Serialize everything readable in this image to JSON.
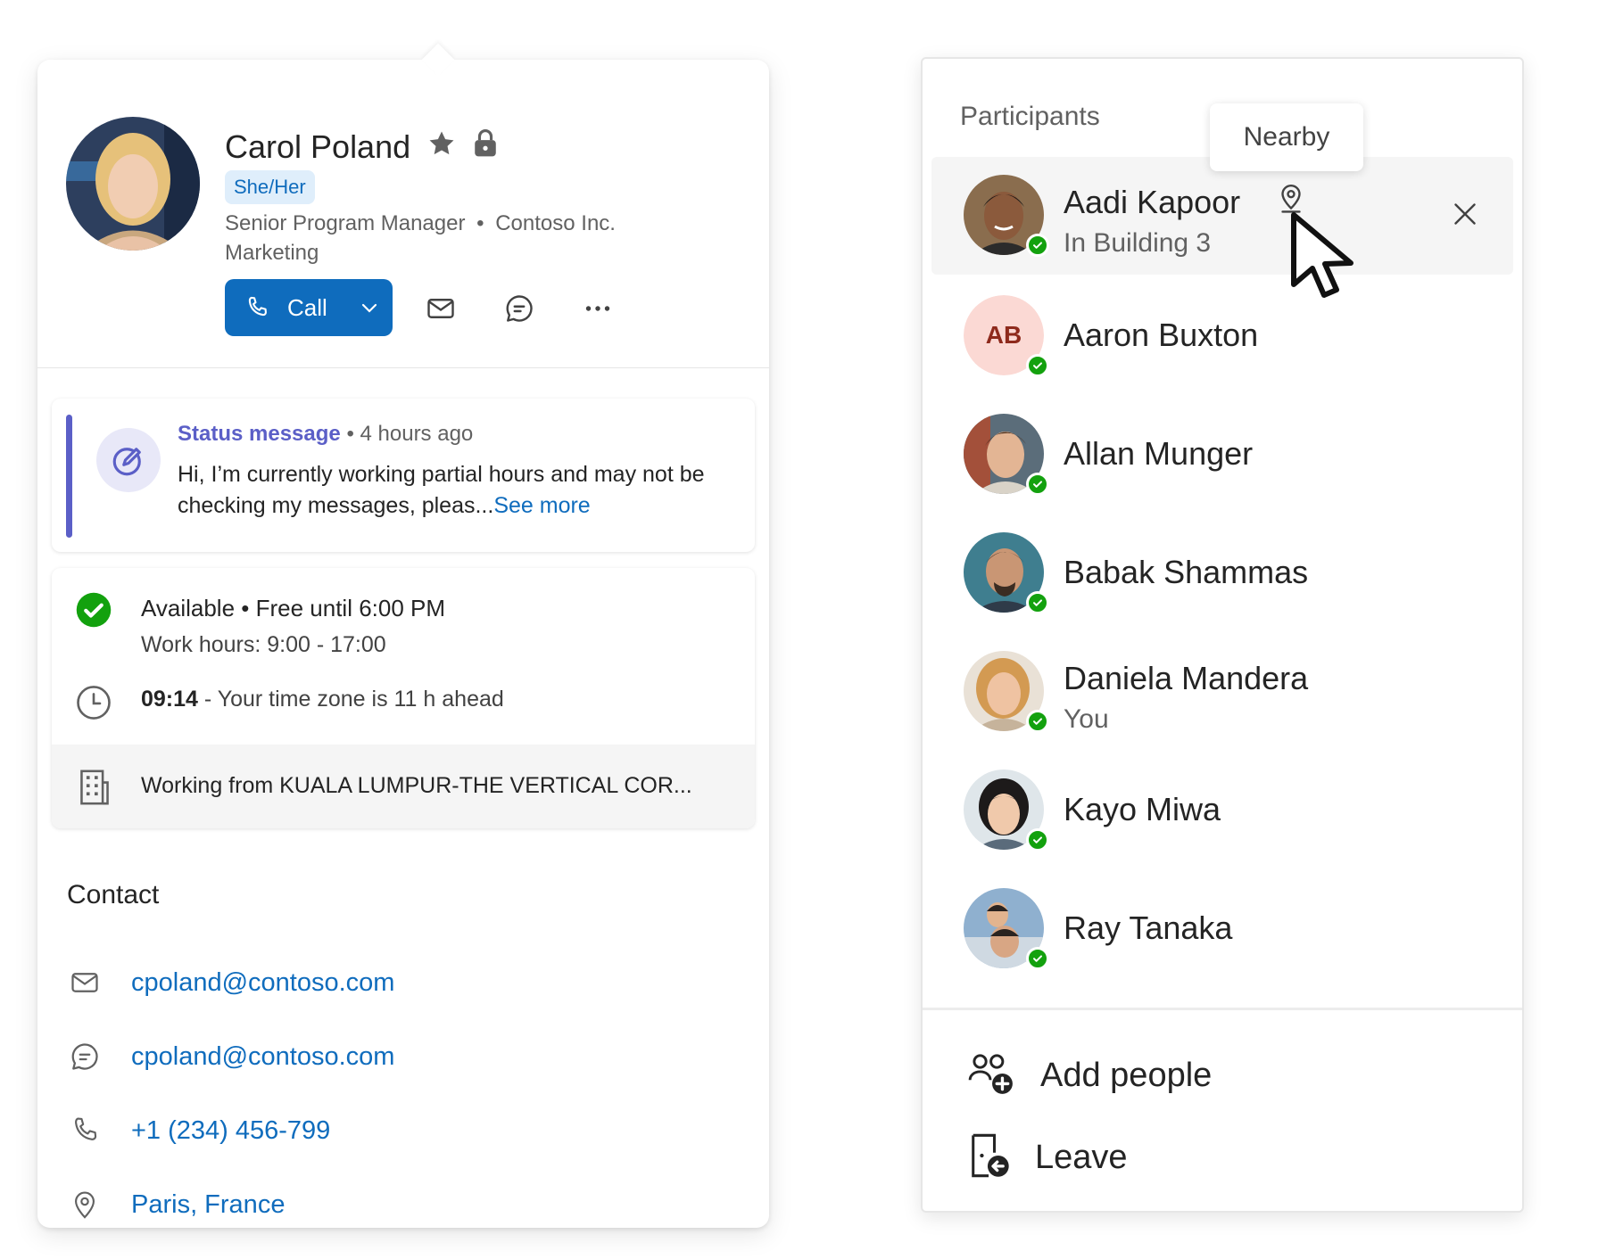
{
  "profile": {
    "name": "Carol Poland",
    "pronouns": "She/Her",
    "job_title": "Senior Program Manager",
    "separator": "•",
    "company": "Contoso Inc.",
    "department": "Marketing",
    "actions": {
      "call_label": "Call"
    },
    "status_message": {
      "title": "Status message",
      "time": "• 4 hours ago",
      "text": "Hi, I’m currently working partial hours and may not be checking my messages, pleas...",
      "see_more": "See more"
    },
    "availability": {
      "status": "Available • Free until 6:00 PM",
      "work_hours": "Work hours: 9:00 - 17:00",
      "local_time": "09:14",
      "timezone_note": " - Your time zone is 11 h ahead",
      "work_location": "Working from KUALA LUMPUR-THE VERTICAL COR..."
    },
    "contact": {
      "title": "Contact",
      "email": "cpoland@contoso.com",
      "chat": "cpoland@contoso.com",
      "phone": "+1 (234) 456-799",
      "location": "Paris, France"
    }
  },
  "participants": {
    "title": "Participants",
    "tooltip": "Nearby",
    "people": [
      {
        "name": "Aadi Kapoor",
        "subtitle": "In Building 3",
        "status": "available"
      },
      {
        "name": "Aaron Buxton",
        "initials": "AB",
        "status": "available"
      },
      {
        "name": "Allan Munger",
        "status": "available"
      },
      {
        "name": "Babak Shammas",
        "status": "available"
      },
      {
        "name": "Daniela Mandera",
        "subtitle": "You",
        "status": "available"
      },
      {
        "name": "Kayo Miwa",
        "status": "available"
      },
      {
        "name": "Ray Tanaka",
        "status": "available"
      }
    ],
    "add_people_label": "Add people",
    "leave_label": "Leave"
  },
  "colors": {
    "brand": "#0f6cbd",
    "status_accent": "#5b5fc7",
    "presence_available": "#13a10e"
  }
}
